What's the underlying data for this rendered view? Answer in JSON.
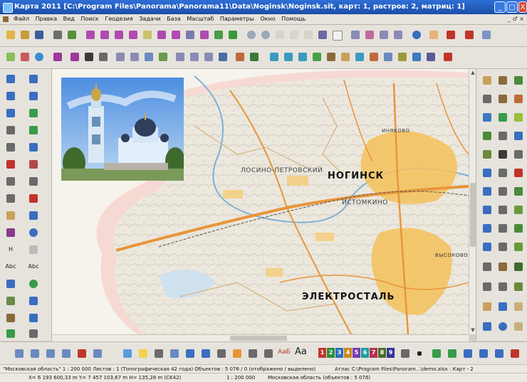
{
  "window": {
    "title": "Карта 2011   [C:\\Program Files\\Panorama\\Panorama11\\Data\\Noginsk\\Noginsk.sit, карт: 1, растров: 2, матриц: 1]",
    "min_glyph": "_",
    "max_glyph": "□",
    "close_glyph": "X"
  },
  "menu": {
    "items": [
      "Файл",
      "Правка",
      "Вид",
      "Поиск",
      "Геодезия",
      "Задачи",
      "База",
      "Масштаб",
      "Параметры",
      "Окно",
      "Помощь"
    ],
    "mdi_controls": "_ ♂ ×"
  },
  "map": {
    "labels": {
      "noginsk": "НОГИНСК",
      "elektrostal": "ЭЛЕКТРОСТАЛЬ",
      "losino": "ЛОСИНО-ПЕТРОВСКИЙ",
      "istomkino": "ИСТОМКИНО",
      "vysokovo": "ВЫСОКОВО",
      "inyakovo": "ИНЯКОВО"
    }
  },
  "left_palette": {
    "labels": [
      "Н",
      "Abc",
      "Abc"
    ]
  },
  "bottom_toolbar": {
    "numbers": [
      "1",
      "2",
      "3",
      "4",
      "5",
      "6",
      "7",
      "8",
      "9"
    ],
    "text_glyphs": [
      "АаБ",
      "Аа"
    ],
    "number_colors": [
      "#c0342b",
      "#2f8f3a",
      "#2f6fc0",
      "#c98a1f",
      "#7a3bb0",
      "#18a0a0",
      "#b8304f",
      "#4a6e22",
      "#333399"
    ]
  },
  "status": {
    "row1": {
      "map_name": "\"Московская область\"  1 : 200 000   Листов : 1   (Топографическая 42 года)  Объектов : 5 076 / 0 (отображено / выделено)",
      "atlas": "Атлас C:\\Program Files\\Panoram...\\demo.alsx : Карт - 2"
    },
    "row2": {
      "coords": "X= 6 193 600,33 m  Y= 7 457 103,67 m  H= 135,28 m  (CK42)",
      "scale": "1 : 200 000",
      "region": "Московская область   (объектов : 5 076)"
    }
  },
  "colors": {
    "titlebar": "#1a4ea8",
    "chrome": "#e6e3dc",
    "road_orange": "#e8953a",
    "city_yellow": "#f5c15a"
  }
}
